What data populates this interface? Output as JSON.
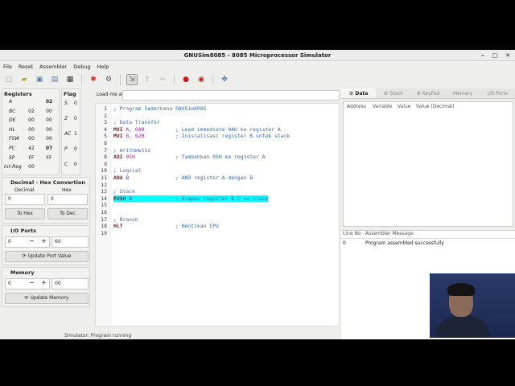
{
  "window": {
    "title": "GNUSim8085 - 8085 Microprocessor Simulator"
  },
  "menu": [
    "File",
    "Reset",
    "Assembler",
    "Debug",
    "Help"
  ],
  "registers": {
    "title": "Registers",
    "rows": [
      {
        "name": "A",
        "v1": "",
        "v2": "02"
      },
      {
        "name": "BC",
        "v1": "02",
        "v2": "00"
      },
      {
        "name": "DE",
        "v1": "00",
        "v2": "00"
      },
      {
        "name": "HL",
        "v1": "00",
        "v2": "00"
      },
      {
        "name": "FSW",
        "v1": "00",
        "v2": "00"
      },
      {
        "name": "PC",
        "v1": "42",
        "v2": "07"
      },
      {
        "name": "SP",
        "v1": "FF",
        "v2": "FF"
      },
      {
        "name": "Int-Reg",
        "v1": "00",
        "v2": ""
      }
    ]
  },
  "flags": {
    "title": "Flag",
    "rows": [
      {
        "name": "S",
        "v": "0"
      },
      {
        "name": "Z",
        "v": "0"
      },
      {
        "name": "AC",
        "v": "1"
      },
      {
        "name": "P",
        "v": "0"
      },
      {
        "name": "C",
        "v": "0"
      }
    ]
  },
  "conv": {
    "title": "Decimal - Hex Convertion",
    "dec_label": "Decimal",
    "hex_label": "Hex",
    "dec_value": "0",
    "hex_value": "0",
    "to_hex": "To Hex",
    "to_dec": "To Dec"
  },
  "io": {
    "title": "I/O Ports",
    "port": "0",
    "minus": "−",
    "plus": "+",
    "value": "60",
    "update": "Update Port Value"
  },
  "memory": {
    "title": "Memory",
    "addr": "0",
    "minus": "−",
    "plus": "+",
    "value": "00",
    "update": "Update Memory"
  },
  "load": {
    "label": "Load me at"
  },
  "code": [
    {
      "n": "1",
      "t": "; Program Sederhana GNUSim8085",
      "cls": "c-com"
    },
    {
      "n": "2",
      "t": "",
      "cls": ""
    },
    {
      "n": "3",
      "t": "; Data Transfer",
      "cls": "c-com"
    },
    {
      "n": "4",
      "kw": "MVI",
      "arg": " A, 0AH",
      "com": "          ; Load immediate 0AH ke register A"
    },
    {
      "n": "5",
      "kw": "MVI",
      "arg": " B, 02H",
      "com": "          ; Inisialisasi register B untuk stack"
    },
    {
      "n": "6",
      "t": "",
      "cls": ""
    },
    {
      "n": "7",
      "t": "; Arithmetic",
      "cls": "c-com"
    },
    {
      "n": "8",
      "kw": "ADI",
      "arg": " 05H",
      "com": "             ; Tambahkan 05H ke register A"
    },
    {
      "n": "9",
      "t": "",
      "cls": ""
    },
    {
      "n": "10",
      "t": "; Logical",
      "cls": "c-com"
    },
    {
      "n": "11",
      "kw": "ANA",
      "arg": " B",
      "com": "               ; AND register A dengan B"
    },
    {
      "n": "12",
      "t": "",
      "cls": ""
    },
    {
      "n": "13",
      "t": "; Stack",
      "cls": "c-com"
    },
    {
      "n": "14",
      "kw": "PUSH",
      "arg": " B",
      "com": "              ; Simpan register B-C ke stack",
      "hl": true
    },
    {
      "n": "15",
      "t": "",
      "cls": ""
    },
    {
      "n": "16",
      "t": "",
      "cls": ""
    },
    {
      "n": "17",
      "t": "; Branch",
      "cls": "c-com"
    },
    {
      "n": "18",
      "kw": "HLT",
      "arg": "",
      "com": "                 ; Hentikan CPU"
    },
    {
      "n": "19",
      "t": "",
      "cls": ""
    }
  ],
  "tabs": [
    "Data",
    "Stack",
    "KeyPad",
    "Memory",
    "I/O Ports"
  ],
  "data_cols": [
    "Address",
    "Variable",
    "Value",
    "Value (Decimal)"
  ],
  "msg_cols": [
    "Line No",
    "Assembler Message"
  ],
  "messages": [
    {
      "line": "0",
      "msg": "Program assembled successfully"
    }
  ],
  "status": "Simulator: Program running"
}
